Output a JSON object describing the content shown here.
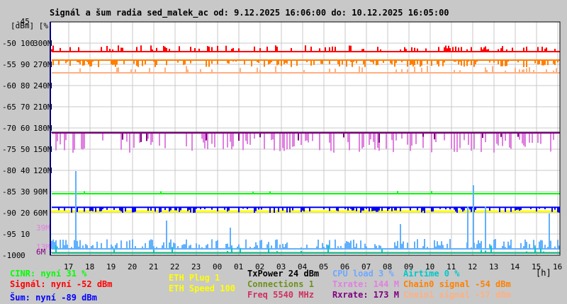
{
  "chart_data": {
    "type": "line",
    "title": "Signál a šum radia sed_malek_ac od: 9.12.2025 16:06:00 do: 10.12.2025 16:05:00",
    "ylabel": "[dBm] [%]",
    "top_tick": "-45",
    "y_ticks_dbm": [
      "-50",
      "-55",
      "-60",
      "-65",
      "-70",
      "-75",
      "-80",
      "-85",
      "-90",
      "-95",
      "-100"
    ],
    "y_ticks_pct": [
      "100",
      "90",
      "80",
      "70",
      "60",
      "50",
      "40",
      "30",
      "20",
      "10",
      "0"
    ],
    "y_ticks_rate": [
      "300M",
      "270M",
      "240M",
      "210M",
      "180M",
      "150M",
      "120M",
      "90M",
      "60M"
    ],
    "rate_marks": [
      "39M",
      "13M",
      "6M"
    ],
    "ylim": [
      -100,
      -45
    ],
    "x_ticks": [
      "17",
      "18",
      "19",
      "20",
      "21",
      "22",
      "23",
      "00",
      "01",
      "02",
      "03",
      "04",
      "05",
      "06",
      "07",
      "08",
      "09",
      "10",
      "11",
      "12",
      "13",
      "14",
      "15",
      "16"
    ],
    "xlabel": "[h]",
    "series": [
      {
        "name": "Signál",
        "color": "#ff0000",
        "level_dbm": -52
      },
      {
        "name": "Chain0 signal",
        "color": "#ff8000",
        "level_dbm": -54
      },
      {
        "name": "Chain1 signal",
        "color": "#ffb080",
        "level_dbm": -57
      },
      {
        "name": "Rxrate",
        "color": "#800080",
        "level_M": 173
      },
      {
        "name": "Txrate",
        "color": "#e080e0",
        "level_M": 144
      },
      {
        "name": "CINR",
        "color": "#00ff00",
        "level_pct": 31
      },
      {
        "name": "Šum",
        "color": "#0000ff",
        "level_dbm": -89
      },
      {
        "name": "ETH Speed",
        "color": "#ffff00",
        "level": 100
      },
      {
        "name": "CPU load",
        "color": "#60b0ff",
        "level_pct": 3
      },
      {
        "name": "Airtime",
        "color": "#00c8c8",
        "level_pct": 0
      },
      {
        "name": "Connections",
        "color": "#709020",
        "level": 1
      }
    ]
  },
  "legend": {
    "cinr": "CINR: nyní 31 %",
    "signal": "Signál: nyní -52 dBm",
    "noise": "Šum: nyní -89 dBm",
    "eth_plug": "ETH Plug 1",
    "eth_speed": "ETH Speed 100",
    "txpower": "TxPower 24 dBm",
    "connections": "Connections 1",
    "freq": "Freq 5540 MHz",
    "cpu": "CPU load 3 %",
    "txrate": "Txrate: 144 M",
    "rxrate": "Rxrate: 173 M",
    "airtime": "Airtime 0 %",
    "chain0": "Chain0 signal -54 dBm",
    "chain1": "Chain1 signal -57 dBm"
  }
}
